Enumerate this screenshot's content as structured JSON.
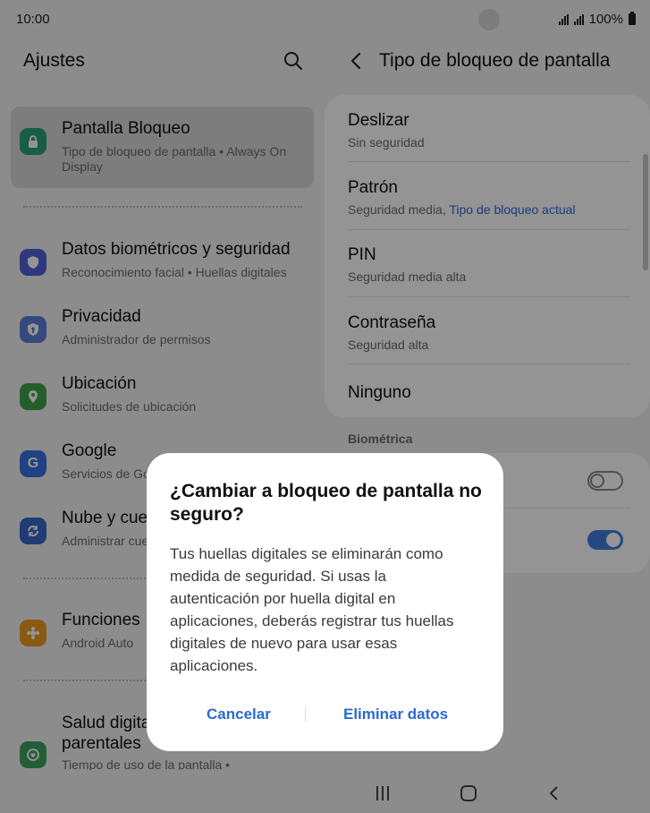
{
  "status": {
    "time": "10:00",
    "battery": "100%"
  },
  "left": {
    "title": "Ajustes",
    "items": [
      {
        "title": "Pantalla Bloqueo",
        "subtitle": "Tipo de bloqueo de pantalla  •  Always On\nDisplay",
        "icon": "lock-icon",
        "color": "#2ba079"
      },
      {
        "title": "Datos biométricos y seguridad",
        "subtitle": "Reconocimiento facial  •  Huellas digitales",
        "icon": "shield-icon",
        "color": "#5062d8"
      },
      {
        "title": "Privacidad",
        "subtitle": "Administrador de permisos",
        "icon": "privacy-shield-icon",
        "color": "#5b7fd9"
      },
      {
        "title": "Ubicación",
        "subtitle": "Solicitudes de ubicación",
        "icon": "location-pin-icon",
        "color": "#3ea24a"
      },
      {
        "title": "Google",
        "subtitle": "Servicios de Go",
        "icon": "google-icon",
        "color": "#3a73e0"
      },
      {
        "title": "Nube y cue",
        "subtitle": "Administrar cue",
        "icon": "sync-icon",
        "color": "#3a67c8"
      },
      {
        "title": "Funciones",
        "subtitle": "Android Auto",
        "icon": "puzzle-icon",
        "color": "#ec9b1e"
      },
      {
        "title": "Salud digita\nparentales",
        "subtitle": "Tiempo de uso de la pantalla  •",
        "icon": "wellbeing-icon",
        "color": "#3da35e"
      }
    ]
  },
  "right": {
    "title": "Tipo de bloqueo de pantalla",
    "options": [
      {
        "title": "Deslizar",
        "subtitle": "Sin seguridad",
        "highlight": ""
      },
      {
        "title": "Patrón",
        "subtitle": "Seguridad media, ",
        "highlight": "Tipo de bloqueo actual"
      },
      {
        "title": "PIN",
        "subtitle": "Seguridad media alta",
        "highlight": ""
      },
      {
        "title": "Contraseña",
        "subtitle": "Seguridad alta",
        "highlight": ""
      },
      {
        "title": "Ninguno",
        "subtitle": "",
        "highlight": ""
      }
    ],
    "biometric_label": "Biométrica",
    "toggles": [
      {
        "state": "off"
      },
      {
        "state": "on"
      }
    ]
  },
  "dialog": {
    "title": "¿Cambiar a bloqueo de pantalla no seguro?",
    "body": "Tus huellas digitales se eliminarán como medida de seguridad. Si usas la autenticación por huella digital en aplicaciones, deberás registrar tus huellas digitales de nuevo para usar esas aplicaciones.",
    "cancel": "Cancelar",
    "confirm": "Eliminar datos"
  },
  "colors": {
    "accent": "#2a6bd1",
    "toggle_on": "#3e7ce0"
  }
}
